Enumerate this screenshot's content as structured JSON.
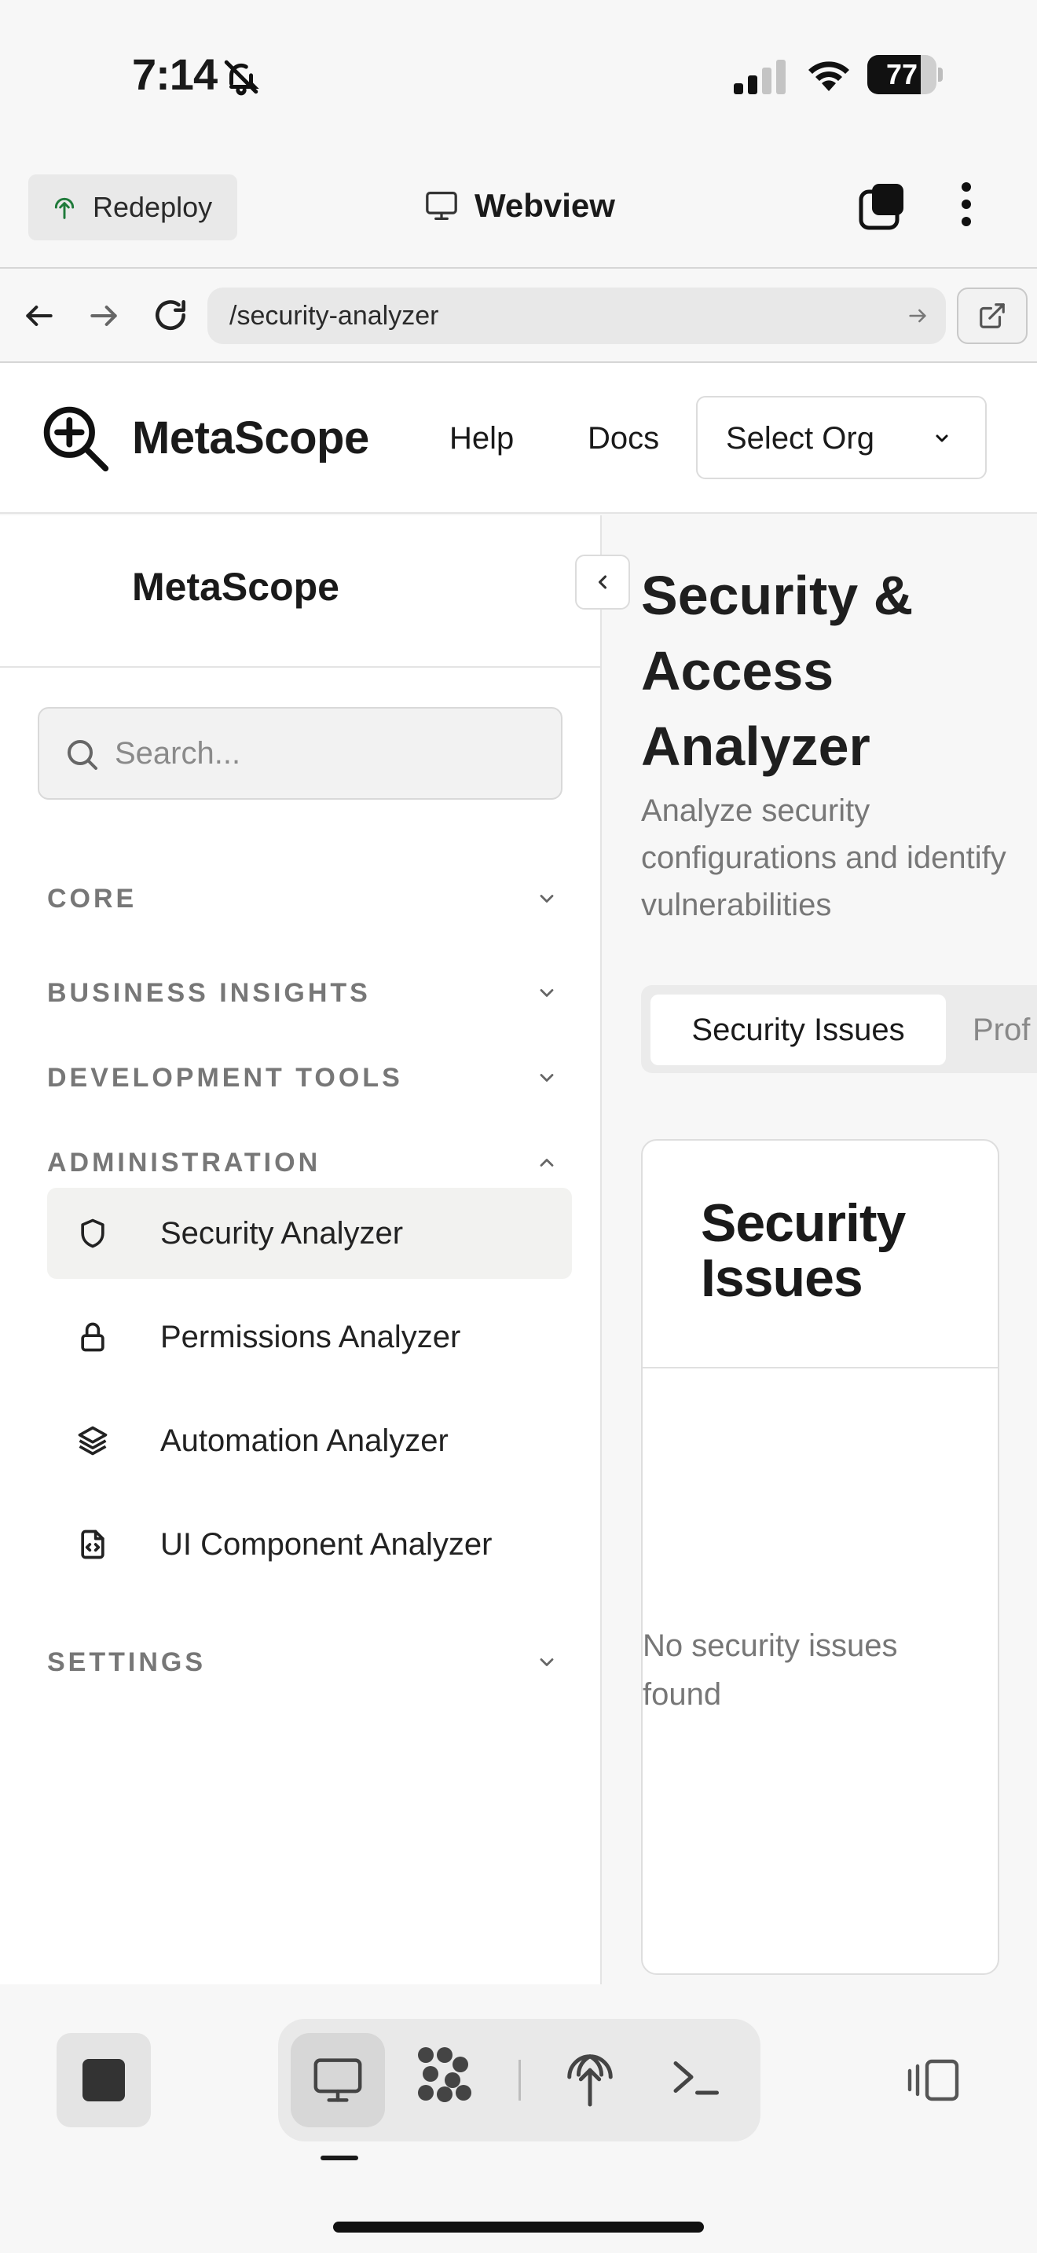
{
  "status": {
    "time": "7:14",
    "battery_percent": "77",
    "battery_level": 0.77,
    "icons": [
      "bell-slash-icon",
      "cellular-signal-icon",
      "wifi-icon",
      "battery-icon"
    ]
  },
  "appbar": {
    "redeploy_label": "Redeploy",
    "title": "Webview"
  },
  "urlbar": {
    "url": "/security-analyzer"
  },
  "site": {
    "logo_text": "MetaScope",
    "nav": {
      "help": "Help",
      "docs": "Docs"
    },
    "org_select": "Select Org"
  },
  "sidebar": {
    "title": "MetaScope",
    "search_placeholder": "Search...",
    "sections": {
      "core": "CORE",
      "business": "BUSINESS INSIGHTS",
      "devtools": "DEVELOPMENT TOOLS",
      "admin": "ADMINISTRATION",
      "settings": "SETTINGS"
    },
    "admin_items": [
      {
        "label": "Security Analyzer",
        "icon": "shield-icon"
      },
      {
        "label": "Permissions Analyzer",
        "icon": "lock-icon"
      },
      {
        "label": "Automation Analyzer",
        "icon": "layers-icon"
      },
      {
        "label": "UI Component Analyzer",
        "icon": "code-file-icon"
      }
    ]
  },
  "main": {
    "title": "Security & Access Analyzer",
    "subtitle": "Analyze security configurations and identify vulnerabilities",
    "tabs": [
      "Security Issues",
      "Prof"
    ],
    "card_title": "Security Issues",
    "empty_text": "No security issues found"
  },
  "colors": {
    "accent_green": "#1f7a3a",
    "active_item_bg": "#f2f2f0"
  }
}
